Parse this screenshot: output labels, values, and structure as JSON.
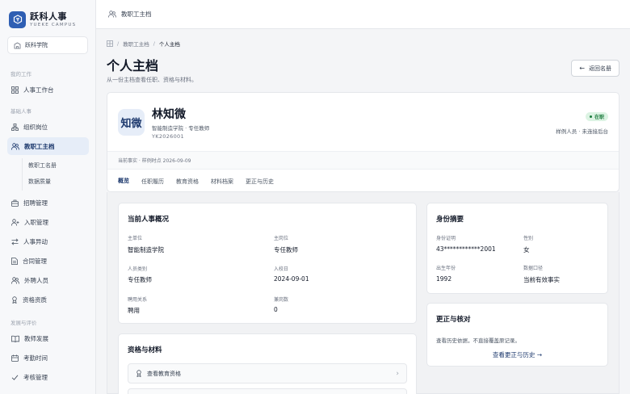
{
  "brand": {
    "name": "跃科人事",
    "sub": "YUEKE CAMPUS"
  },
  "school": {
    "label": "跃科学院"
  },
  "sidebar": {
    "groups": [
      {
        "title": "我的工作"
      },
      {
        "title": "基础人事"
      },
      {
        "title": "发展与评价"
      }
    ],
    "items": {
      "workbench": "人事工作台",
      "org": "组织岗位",
      "profile": "教职工主档",
      "profile_list": "教职工名册",
      "data_quality": "数据质量",
      "recruit": "招聘管理",
      "onboard": "入职管理",
      "transfer": "人事异动",
      "contract": "合同管理",
      "external": "外聘人员",
      "qualification": "资格资质",
      "development": "教师发展",
      "attendance": "考勤时间",
      "assessment": "考核管理"
    }
  },
  "topbar": {
    "title": "教职工主档"
  },
  "breadcrumb": {
    "parent": "教职工主档",
    "current": "个人主档"
  },
  "page": {
    "title": "个人主档",
    "subtitle": "从一份主档查看任职、资格与材料。",
    "back_label": "返回名册"
  },
  "profile": {
    "avatar_text": "知微",
    "name": "林知微",
    "meta": "智能制造学院 · 专任教师",
    "id": "YK2026001",
    "status": "在职",
    "status_color": "#1b7a3d",
    "status_note": "样例人员 · 未连接后台",
    "meta_band": "当前事实 · 样例时点 2026-09-09"
  },
  "tabs": [
    "概览",
    "任职履历",
    "教育资格",
    "材料档案",
    "更正与历史"
  ],
  "overview": {
    "title": "当前人事概况",
    "fields": [
      {
        "label": "主单位",
        "value": "智能制造学院"
      },
      {
        "label": "主岗位",
        "value": "专任教师"
      },
      {
        "label": "人员类别",
        "value": "专任教师"
      },
      {
        "label": "入校日",
        "value": "2024-09-01"
      },
      {
        "label": "聘用关系",
        "value": "聘用"
      },
      {
        "label": "兼岗数",
        "value": "0"
      }
    ]
  },
  "identity": {
    "title": "身份摘要",
    "fields": [
      {
        "label": "身份证明",
        "value": "43************2001"
      },
      {
        "label": "性别",
        "value": "女"
      },
      {
        "label": "出生年份",
        "value": "1992"
      },
      {
        "label": "数据口径",
        "value": "当前有效事实"
      }
    ]
  },
  "materials": {
    "title": "资格与材料",
    "link_label": "查看教育资格"
  },
  "verify": {
    "title": "更正与核对",
    "desc": "查看历史依据，不直接覆盖原记录。",
    "link_label": "查看更正与历史"
  },
  "colors": {
    "accent": "#2f5fb3",
    "accent_dark": "#1e3a6e",
    "active_bg": "#e6edf8"
  }
}
